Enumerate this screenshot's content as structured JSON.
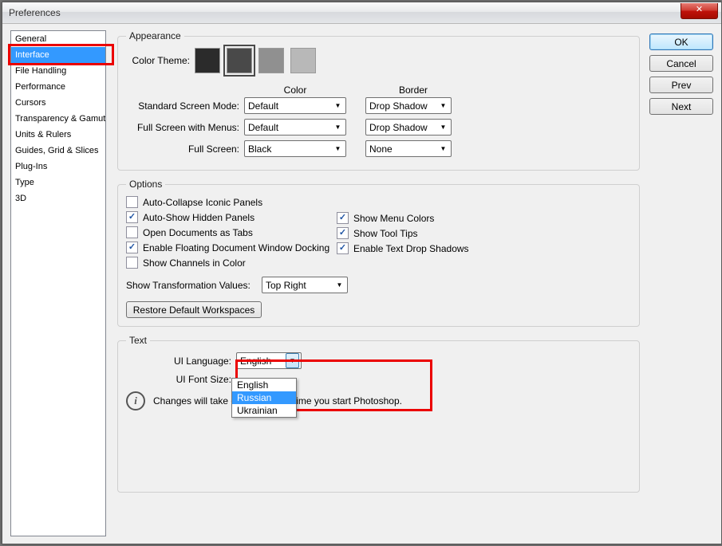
{
  "window": {
    "title": "Preferences",
    "close_glyph": "✕"
  },
  "categories": [
    "General",
    "Interface",
    "File Handling",
    "Performance",
    "Cursors",
    "Transparency & Gamut",
    "Units & Rulers",
    "Guides, Grid & Slices",
    "Plug-Ins",
    "Type",
    "3D"
  ],
  "selected_category": "Interface",
  "buttons": {
    "ok": "OK",
    "cancel": "Cancel",
    "prev": "Prev",
    "next": "Next"
  },
  "appearance_group": {
    "legend": "Appearance",
    "color_theme_label": "Color Theme:",
    "swatches": [
      "#2B2B2B",
      "#494949",
      "#909090",
      "#B8B8B8"
    ],
    "selected_swatch": 1,
    "color_header": "Color",
    "border_header": "Border",
    "rows": [
      {
        "label": "Standard Screen Mode:",
        "color": "Default",
        "border": "Drop Shadow"
      },
      {
        "label": "Full Screen with Menus:",
        "color": "Default",
        "border": "Drop Shadow"
      },
      {
        "label": "Full Screen:",
        "color": "Black",
        "border": "None"
      }
    ]
  },
  "options_group": {
    "legend": "Options",
    "left": [
      {
        "label": "Auto-Collapse Iconic Panels",
        "checked": false
      },
      {
        "label": "Auto-Show Hidden Panels",
        "checked": true
      },
      {
        "label": "Open Documents as Tabs",
        "checked": false
      },
      {
        "label": "Enable Floating Document Window Docking",
        "checked": true
      },
      {
        "label": "Show Channels in Color",
        "checked": false
      }
    ],
    "right": [
      {
        "label": "Show Menu Colors",
        "checked": true
      },
      {
        "label": "Show Tool Tips",
        "checked": true
      },
      {
        "label": "Enable Text Drop Shadows",
        "checked": true
      }
    ],
    "transform_label": "Show Transformation Values:",
    "transform_value": "Top Right",
    "restore_btn": "Restore Default Workspaces"
  },
  "text_group": {
    "legend": "Text",
    "ui_lang_label": "UI Language:",
    "ui_lang_value": "English",
    "ui_font_label": "UI Font Size:",
    "dropdown_items": [
      "English",
      "Russian",
      "Ukrainian"
    ],
    "dropdown_selected": "Russian",
    "note": "Changes will take effect the next time you start Photoshop."
  }
}
